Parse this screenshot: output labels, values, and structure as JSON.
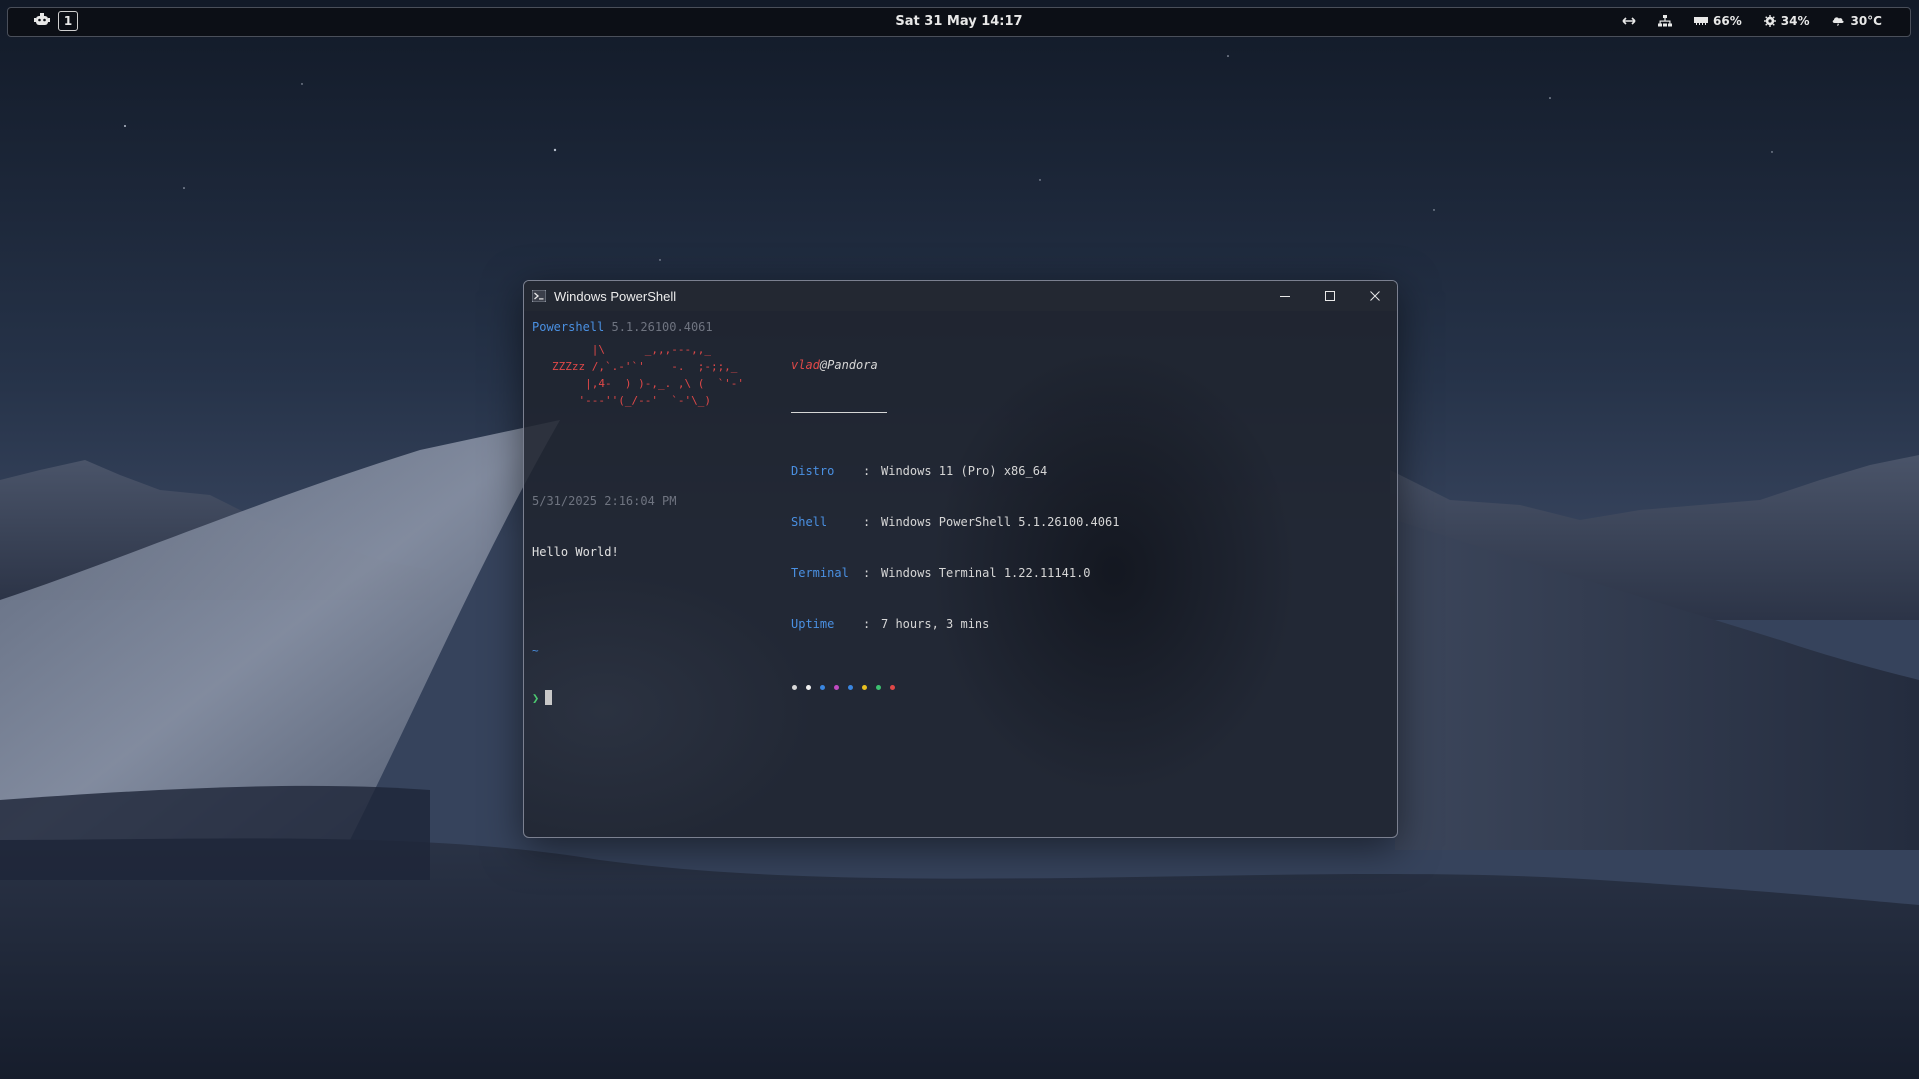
{
  "topbar": {
    "workspace": "1",
    "clock": "Sat 31 May 14:17",
    "status": {
      "memory": "66%",
      "cpu": "34%",
      "weather": "30°C"
    }
  },
  "window": {
    "title": "Windows PowerShell"
  },
  "terminal": {
    "header_app": "Powershell",
    "header_version": "5.1.26100.4061",
    "user": "vlad",
    "host": "@Pandora",
    "ascii_art": [
      "      |\\      _,,,---,,_",
      "ZZZzz /,`.-'`'    -.  ;-;;,_",
      "     |,4-  ) )-,_. ,\\ (  `'-'",
      "    '---''(_/--'  `-'\\_)"
    ],
    "info": [
      {
        "key": "Distro",
        "value": "Windows 11 (Pro) x86_64"
      },
      {
        "key": "Shell",
        "value": "Windows PowerShell 5.1.26100.4061"
      },
      {
        "key": "Terminal",
        "value": "Windows Terminal 1.22.11141.0"
      },
      {
        "key": "Uptime",
        "value": "7 hours, 3 mins"
      }
    ],
    "separator": ":",
    "palette": [
      "#d8d8d8",
      "#f0f0f0",
      "#3a86e0",
      "#c04ac0",
      "#3a86e0",
      "#e8c020",
      "#3cc070",
      "#e04848"
    ],
    "timestamp": "5/31/2025 2:16:04 PM",
    "output": "Hello World!",
    "path": "~",
    "prompt_symbol": "❯"
  }
}
